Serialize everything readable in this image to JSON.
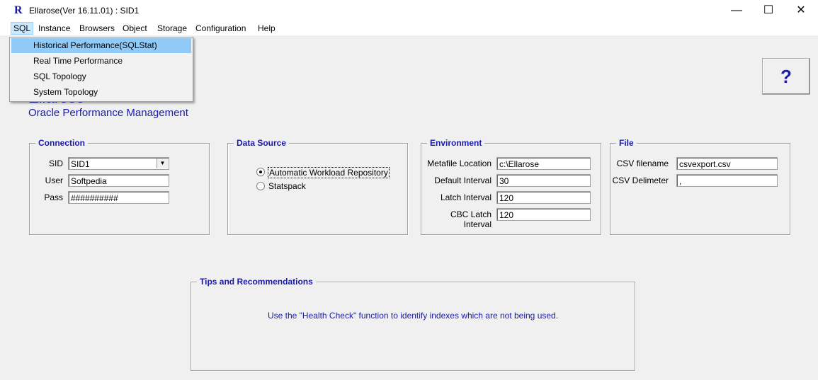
{
  "window": {
    "icon": "R",
    "title": "Ellarose(Ver 16.11.01) : SID1",
    "minimize_glyph": "—",
    "maximize_glyph": "☐",
    "close_glyph": "✕"
  },
  "menubar": {
    "items": [
      "SQL",
      "Instance",
      "Browsers",
      "Object",
      "Storage",
      "Configuration",
      "Help"
    ]
  },
  "sql_menu": {
    "items": [
      "Historical Performance(SQLStat)",
      "Real Time Performance",
      "SQL Topology",
      "System Topology"
    ],
    "highlighted": "Historical Performance(SQLStat)"
  },
  "brand": {
    "partial_title": "Ellarose",
    "subtitle": "Oracle Performance Management"
  },
  "help_button": {
    "label": "?"
  },
  "connection": {
    "legend": "Connection",
    "sid_label": "SID",
    "sid_value": "SID1",
    "sid_dropdown_glyph": "▼",
    "user_label": "User",
    "user_value": "Softpedia",
    "pass_label": "Pass",
    "pass_value": "##########"
  },
  "data_source": {
    "legend": "Data Source",
    "options": [
      "Automatic Workload Repository",
      "Statspack"
    ],
    "selected": "Automatic Workload Repository"
  },
  "environment": {
    "legend": "Environment",
    "metafile_label": "Metafile Location",
    "metafile_value": "c:\\Ellarose",
    "default_interval_label": "Default Interval",
    "default_interval_value": "30",
    "latch_interval_label": "Latch Interval",
    "latch_interval_value": "120",
    "cbc_latch_interval_label": "CBC Latch Interval",
    "cbc_latch_interval_value": "120"
  },
  "file": {
    "legend": "File",
    "csv_filename_label": "CSV filename",
    "csv_filename_value": "csvexport.csv",
    "csv_delimeter_label": "CSV Delimeter",
    "csv_delimeter_value": ","
  },
  "tips": {
    "legend": "Tips and Recommendations",
    "text": "Use the \"Health Check\" function to identify indexes which are not being used."
  },
  "colors": {
    "accent_blue": "#1a1aa8",
    "menu_highlight": "#91c9f7"
  }
}
